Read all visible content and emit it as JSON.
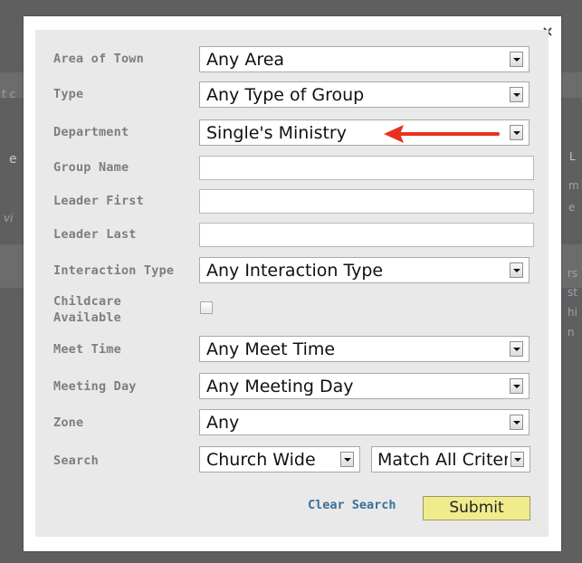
{
  "background_fragments": [
    "t c",
    "e",
    "vi",
    "L",
    "m",
    "e",
    "rs",
    "st",
    "hi",
    "n"
  ],
  "modal": {
    "close_glyph": "×",
    "fields": [
      {
        "label": "Area of Town",
        "type": "select",
        "value": "Any Area"
      },
      {
        "label": "Type",
        "type": "select",
        "value": "Any Type of Group"
      },
      {
        "label": "Department",
        "type": "select",
        "value": "Single's Ministry"
      },
      {
        "label": "Group Name",
        "type": "text",
        "value": ""
      },
      {
        "label": "Leader First",
        "type": "text",
        "value": ""
      },
      {
        "label": "Leader Last",
        "type": "text",
        "value": ""
      },
      {
        "label": "Interaction Type",
        "type": "select",
        "value": "Any Interaction Type"
      },
      {
        "label_line1": "Childcare",
        "label_line2": "Available",
        "type": "checkbox",
        "checked": false
      },
      {
        "label": "Meet Time",
        "type": "select",
        "value": "Any Meet Time"
      },
      {
        "label": "Meeting Day",
        "type": "select",
        "value": "Any Meeting Day"
      },
      {
        "label": "Zone",
        "type": "select",
        "value": "Any"
      },
      {
        "label": "Search",
        "type": "select-pair",
        "value": "Church Wide",
        "value2": "Match All Criteria"
      }
    ],
    "clear_label": "Clear Search",
    "submit_label": "Submit"
  },
  "annotation": {
    "arrow_color": "#e8321f"
  },
  "colors": {
    "panel_bg": "#e9e9e9",
    "label": "#7e7e7e",
    "link": "#3a6f99",
    "submit_bg": "#f0ec8c",
    "overlay": "#5f5f5f"
  }
}
